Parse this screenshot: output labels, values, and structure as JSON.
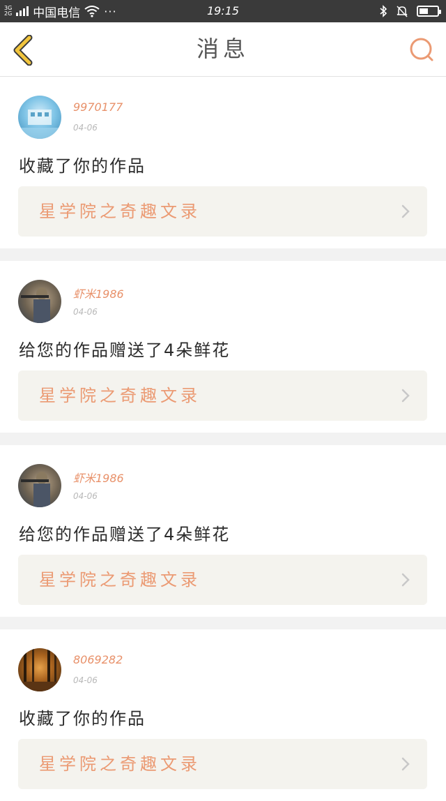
{
  "status_bar": {
    "network_top": "3G",
    "network_bottom": "2G",
    "carrier": "中国电信",
    "more": "···",
    "time": "19:15",
    "battery_level": 0.5
  },
  "header": {
    "title": "消息"
  },
  "colors": {
    "accent": "#eb9a73",
    "back_icon": "#f2c53d",
    "username": "#e8916a"
  },
  "messages": [
    {
      "username": "9970177",
      "date": "04-06",
      "action": "收藏了你的作品",
      "work_title": "星学院之奇趣文录",
      "avatar": "landscape-avatar"
    },
    {
      "username": "虾米1986",
      "date": "04-06",
      "action": "给您的作品赠送了4朵鲜花",
      "work_title": "星学院之奇趣文录",
      "avatar": "soldier-avatar"
    },
    {
      "username": "虾米1986",
      "date": "04-06",
      "action": "给您的作品赠送了4朵鲜花",
      "work_title": "星学院之奇趣文录",
      "avatar": "soldier-avatar"
    },
    {
      "username": "8069282",
      "date": "04-06",
      "action": "收藏了你的作品",
      "work_title": "星学院之奇趣文录",
      "avatar": "forest-avatar"
    }
  ]
}
